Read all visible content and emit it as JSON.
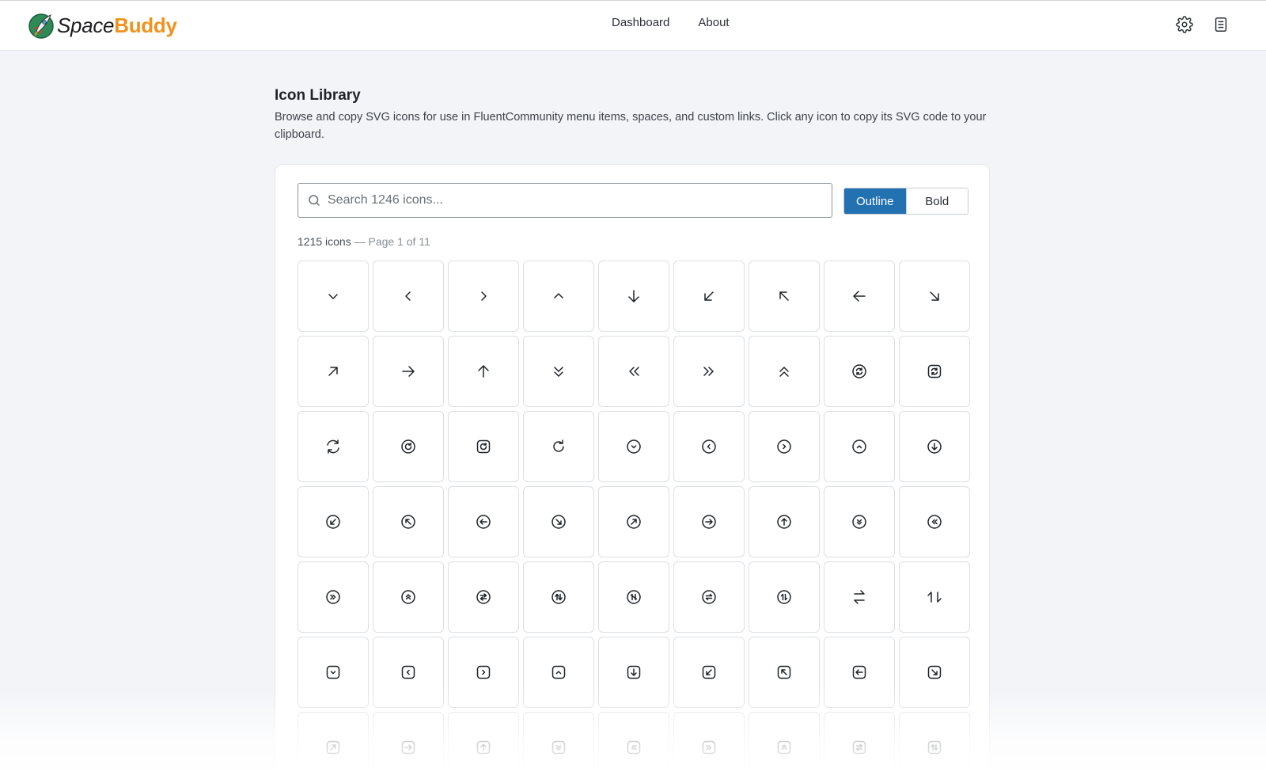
{
  "brand": {
    "part1": "Space",
    "part2": "Buddy",
    "accent": "#f0921d"
  },
  "nav": [
    {
      "label": "Dashboard"
    },
    {
      "label": "About"
    }
  ],
  "header_icons": [
    "gear-icon",
    "document-icon"
  ],
  "page": {
    "title": "Icon Library",
    "description": "Browse and copy SVG icons for use in FluentCommunity menu items, spaces, and custom links. Click any icon to copy its SVG code to your clipboard."
  },
  "search": {
    "placeholder": "Search 1246 icons...",
    "value": ""
  },
  "style_toggle": {
    "options": [
      "Outline",
      "Bold"
    ],
    "selected": "Outline",
    "accent": "#2271b1"
  },
  "results": {
    "count": "1215 icons",
    "page_info": "— Page 1 of 11"
  },
  "icons": [
    "chevron-down",
    "chevron-left",
    "chevron-right",
    "chevron-up",
    "arrow-down",
    "arrow-down-left",
    "arrow-up-left",
    "arrow-left",
    "arrow-down-right",
    "arrow-up-right",
    "arrow-right",
    "arrow-up",
    "chevrons-down",
    "chevrons-left",
    "chevrons-right",
    "chevrons-up",
    "refresh-circle",
    "refresh-square",
    "refresh",
    "rotate-right-circle",
    "rotate-right-square",
    "rotate-right",
    "circle-chevron-down",
    "circle-chevron-left",
    "circle-chevron-right",
    "circle-chevron-up",
    "circle-arrow-down",
    "circle-arrow-down-left",
    "circle-arrow-up-left",
    "circle-arrow-left",
    "circle-arrow-down-right",
    "circle-arrow-up-right",
    "circle-arrow-right",
    "circle-arrow-up",
    "circle-chevrons-down",
    "circle-chevrons-left",
    "circle-chevrons-right",
    "circle-chevrons-up",
    "circle-swap-horizontal",
    "circle-swap-vertical",
    "circle-swap-diagonal",
    "circle-swap-horizontal-alt",
    "circle-swap-vertical-alt",
    "swap-horizontal",
    "swap-vertical",
    "square-chevron-down",
    "square-chevron-left",
    "square-chevron-right",
    "square-chevron-up",
    "square-arrow-down",
    "square-arrow-down-left",
    "square-arrow-up-left",
    "square-arrow-left",
    "square-arrow-down-right",
    "square-arrow-up-right",
    "square-arrow-right",
    "square-arrow-up",
    "square-chevrons-down",
    "square-chevrons-left",
    "square-chevrons-right",
    "square-chevrons-up",
    "square-swap-horizontal",
    "square-swap-vertical"
  ]
}
